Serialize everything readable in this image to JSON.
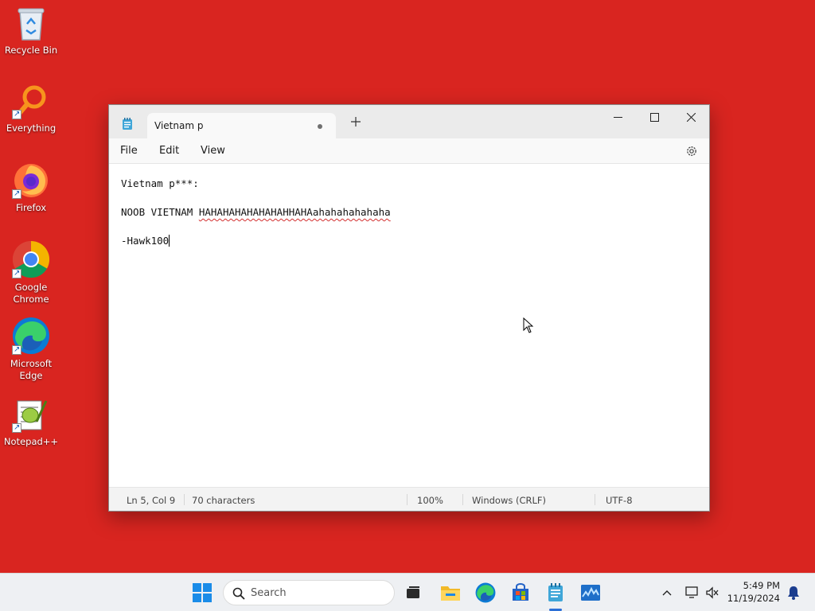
{
  "desktop": {
    "icons": [
      {
        "label": "Recycle Bin"
      },
      {
        "label": "Everything"
      },
      {
        "label": "Firefox"
      },
      {
        "label": "Google Chrome"
      },
      {
        "label": "Microsoft Edge"
      },
      {
        "label": "Notepad++"
      }
    ]
  },
  "notepad": {
    "tab_title": "Vietnam p",
    "menu": {
      "file": "File",
      "edit": "Edit",
      "view": "View"
    },
    "lines": {
      "l1": "Vietnam p***:",
      "l3a": "NOOB VIETNAM ",
      "l3b": "HAHAHAHAHAHAHAHHAHAahahahahahaha",
      "l5": "-Hawk100"
    },
    "status": {
      "position": "Ln 5, Col 9",
      "characters": "70 characters",
      "zoom": "100%",
      "line_ending": "Windows (CRLF)",
      "encoding": "UTF-8"
    }
  },
  "taskbar": {
    "search_placeholder": "Search",
    "clock_time": "5:49 PM",
    "clock_date": "11/19/2024"
  },
  "colors": {
    "desktop_bg": "#d92520",
    "accent": "#2b6fd6"
  }
}
